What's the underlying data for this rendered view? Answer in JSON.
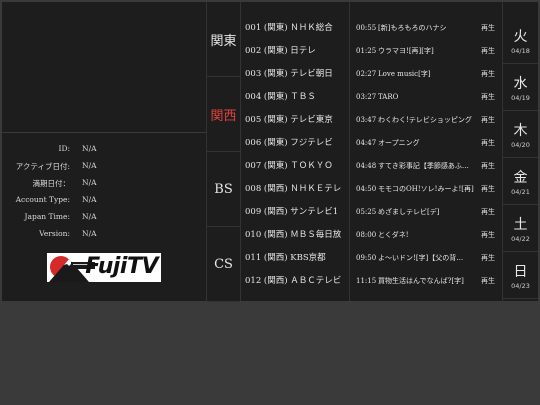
{
  "info": {
    "rows": [
      {
        "label": "ID:",
        "value": "N/A"
      },
      {
        "label": "アクティブ日付:",
        "value": "N/A"
      },
      {
        "label": "満期日付：",
        "value": "N/A"
      },
      {
        "label": "Account Type:",
        "value": "N/A"
      },
      {
        "label": "Japan Time:",
        "value": "N/A"
      },
      {
        "label": "Version:",
        "value": "N/A"
      }
    ]
  },
  "logo": {
    "brand": "FujiTV"
  },
  "regions": [
    "関東",
    "関西",
    "BS",
    "CS"
  ],
  "active_region_index": 1,
  "accent_color": "#e0423e",
  "channels": [
    "001 (関東) ＮＨＫ総合",
    "002 (関東) 日テレ",
    "003 (関東) テレビ朝日",
    "004 (関東) ＴＢＳ",
    "005 (関東) テレビ東京",
    "006 (関東) フジテレビ",
    "007 (関東) ＴＯＫＹＯ",
    "008 (関西) ＮＨＫＥテレ",
    "009 (関西) サンテレビ1",
    "010 (関西) ＭＢＳ毎日放",
    "011 (関西) KBS京都",
    "012 (関西) ＡＢＣテレビ"
  ],
  "programs": [
    {
      "time": "00:55",
      "title": "[新]もろもろのハナシ",
      "action": "再生"
    },
    {
      "time": "01:25",
      "title": "ウラマヨ![再][字]",
      "action": "再生"
    },
    {
      "time": "02:27",
      "title": "Love music[字]",
      "action": "再生"
    },
    {
      "time": "03:27",
      "title": "TARO",
      "action": "再生"
    },
    {
      "time": "03:47",
      "title": "わくわく!テレビショッピング",
      "action": "再生"
    },
    {
      "time": "04:47",
      "title": "オープニング",
      "action": "再生"
    },
    {
      "time": "04:48",
      "title": "すてき彩事記【季節感あふれる】",
      "action": "再生"
    },
    {
      "time": "04:50",
      "title": "モモコのOH!ソレ!みーよ![再]",
      "action": "再生"
    },
    {
      "time": "05:25",
      "title": "めざましテレビ[デ]",
      "action": "再生"
    },
    {
      "time": "08:00",
      "title": "とくダネ!",
      "action": "再生"
    },
    {
      "time": "09:50",
      "title": "よ～いドン![字]【父の背…",
      "action": "再生"
    },
    {
      "time": "11:15",
      "title": "買物生活はんでなんば?[字]",
      "action": "再生"
    }
  ],
  "days": [
    {
      "dow": "火",
      "date": "04/18"
    },
    {
      "dow": "水",
      "date": "04/19"
    },
    {
      "dow": "木",
      "date": "04/20"
    },
    {
      "dow": "金",
      "date": "04/21"
    },
    {
      "dow": "土",
      "date": "04/22"
    },
    {
      "dow": "日",
      "date": "04/23"
    }
  ]
}
